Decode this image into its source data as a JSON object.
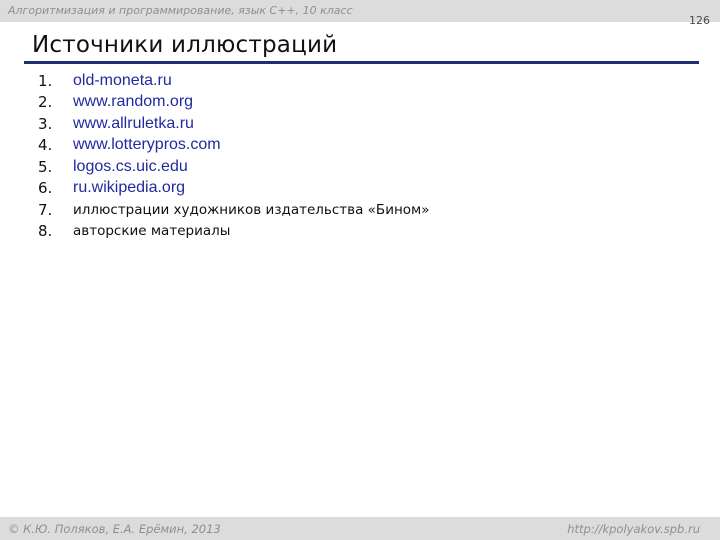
{
  "header": {
    "course": "Алгоритмизация и программирование, язык  C++, 10 класс",
    "page_number": "126"
  },
  "title": "Источники иллюстраций",
  "sources": [
    {
      "num": "1.",
      "text": "old-moneta.ru"
    },
    {
      "num": "2.",
      "text": "www.random.org"
    },
    {
      "num": "3.",
      "text": "www.allruletka.ru"
    },
    {
      "num": "4.",
      "text": "www.lotterypros.com"
    },
    {
      "num": "5.",
      "text": "logos.cs.uic.edu"
    },
    {
      "num": "6.",
      "text": "ru.wikipedia.org"
    },
    {
      "num": "7.",
      "text": "иллюстрации художников издательства «Бином»"
    },
    {
      "num": "8.",
      "text": "авторские материалы"
    }
  ],
  "footer": {
    "copyright": "© К.Ю. Поляков, Е.А. Ерёмин, 2013",
    "url": "http://kpolyakov.spb.ru"
  },
  "colors": {
    "link": "#1f2aa0",
    "rule": "#1f2f6f",
    "bar": "#dcdcdc"
  }
}
